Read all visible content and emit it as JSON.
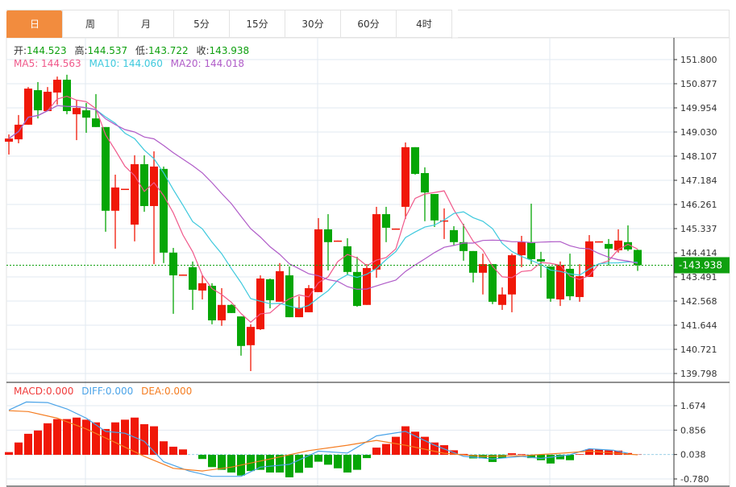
{
  "tabs": [
    {
      "label": "日",
      "active": true
    },
    {
      "label": "周"
    },
    {
      "label": "月"
    },
    {
      "label": "5分"
    },
    {
      "label": "15分"
    },
    {
      "label": "30分"
    },
    {
      "label": "60分"
    },
    {
      "label": "4时"
    }
  ],
  "ohlc_legend": {
    "open_label": "开:",
    "open": "144.523",
    "high_label": "高:",
    "high": "144.537",
    "low_label": "低:",
    "low": "143.722",
    "close_label": "收:",
    "close": "143.938"
  },
  "ma_legend": {
    "ma5": "MA5: 144.563",
    "ma10": "MA10: 144.060",
    "ma20": "MA20: 144.018"
  },
  "macd_legend": {
    "macd": "MACD:0.000",
    "diff": "DIFF:0.000",
    "dea": "DEA:0.000"
  },
  "colors": {
    "up": "#f01808",
    "down": "#06a606",
    "ma5": "#f0588a",
    "ma10": "#3ec9dd",
    "ma20": "#b05cc8",
    "diff": "#4aa3e8",
    "dea": "#f57c20",
    "active_tab": "#f28c3e"
  },
  "chart_data": [
    {
      "type": "candlestick",
      "title": "K线",
      "last_price": "143.938",
      "yticks": [
        "151.800",
        "150.877",
        "149.954",
        "149.030",
        "148.107",
        "147.184",
        "146.261",
        "145.337",
        "144.414",
        "143.491",
        "142.568",
        "141.644",
        "140.721",
        "139.798"
      ],
      "ylim": [
        139.798,
        151.8
      ],
      "candles": [
        [
          148.66,
          148.94,
          148.17,
          148.78
        ],
        [
          148.75,
          149.68,
          148.6,
          149.31
        ],
        [
          149.31,
          150.75,
          149.31,
          150.69
        ],
        [
          150.63,
          150.94,
          149.55,
          149.86
        ],
        [
          149.83,
          150.75,
          149.83,
          150.57
        ],
        [
          150.54,
          151.15,
          150.08,
          151.03
        ],
        [
          151.03,
          151.22,
          149.71,
          149.83
        ],
        [
          149.71,
          150.26,
          148.72,
          149.95
        ],
        [
          149.86,
          150.14,
          149.0,
          149.58
        ],
        [
          149.55,
          150.48,
          149.22,
          149.22
        ],
        [
          149.22,
          149.22,
          145.22,
          146.02
        ],
        [
          146.02,
          147.4,
          144.57,
          146.91
        ],
        [
          146.85,
          146.85,
          146.85,
          146.86
        ],
        [
          145.49,
          148.14,
          144.85,
          147.8
        ],
        [
          147.8,
          148.14,
          145.98,
          146.2
        ],
        [
          146.2,
          148.29,
          143.98,
          147.71
        ],
        [
          147.62,
          147.71,
          144.02,
          144.42
        ],
        [
          144.42,
          144.6,
          142.08,
          143.55
        ],
        [
          143.57,
          143.58,
          143.57,
          143.58
        ],
        [
          143.86,
          144.08,
          142.23,
          143.0
        ],
        [
          142.97,
          143.55,
          142.63,
          143.25
        ],
        [
          143.15,
          143.25,
          141.68,
          141.83
        ],
        [
          141.83,
          143.06,
          141.62,
          142.42
        ],
        [
          142.42,
          142.45,
          142.11,
          142.11
        ],
        [
          141.98,
          141.98,
          140.48,
          140.85
        ],
        [
          140.88,
          141.68,
          139.89,
          141.58
        ],
        [
          141.49,
          143.55,
          141.46,
          143.43
        ],
        [
          143.4,
          143.43,
          142.29,
          142.6
        ],
        [
          142.54,
          144.02,
          142.54,
          143.71
        ],
        [
          143.55,
          143.89,
          141.95,
          141.95
        ],
        [
          141.95,
          142.75,
          141.95,
          142.32
        ],
        [
          142.14,
          143.18,
          142.14,
          143.06
        ],
        [
          142.91,
          145.74,
          142.91,
          145.31
        ],
        [
          145.31,
          145.89,
          143.74,
          144.82
        ],
        [
          144.87,
          144.88,
          144.87,
          144.88
        ],
        [
          144.66,
          144.97,
          143.55,
          143.68
        ],
        [
          143.68,
          144.26,
          142.35,
          142.38
        ],
        [
          142.42,
          143.98,
          142.42,
          143.83
        ],
        [
          143.77,
          146.17,
          143.46,
          145.89
        ],
        [
          145.89,
          146.17,
          144.82,
          145.37
        ],
        [
          145.33,
          145.34,
          145.33,
          145.34
        ],
        [
          146.17,
          148.63,
          145.71,
          148.45
        ],
        [
          148.45,
          148.45,
          147.4,
          147.43
        ],
        [
          147.46,
          147.68,
          145.62,
          146.72
        ],
        [
          146.66,
          146.66,
          145.4,
          145.65
        ],
        [
          145.64,
          146.11,
          144.94,
          145.65
        ],
        [
          145.28,
          145.43,
          144.69,
          144.82
        ],
        [
          144.82,
          145.52,
          144.11,
          144.48
        ],
        [
          144.48,
          144.48,
          143.28,
          143.65
        ],
        [
          143.65,
          144.38,
          142.82,
          143.98
        ],
        [
          143.98,
          143.98,
          142.45,
          142.54
        ],
        [
          142.42,
          143.09,
          142.23,
          142.82
        ],
        [
          142.82,
          144.38,
          142.14,
          144.32
        ],
        [
          144.32,
          145.06,
          143.86,
          144.82
        ],
        [
          144.82,
          146.29,
          143.98,
          144.17
        ],
        [
          144.17,
          144.45,
          143.46,
          144.08
        ],
        [
          143.89,
          143.89,
          142.54,
          142.66
        ],
        [
          142.63,
          144.08,
          142.38,
          143.95
        ],
        [
          143.8,
          144.38,
          142.6,
          142.75
        ],
        [
          142.72,
          143.98,
          142.54,
          143.52
        ],
        [
          143.49,
          145.09,
          143.49,
          144.85
        ],
        [
          144.84,
          144.85,
          144.84,
          144.85
        ],
        [
          144.75,
          144.94,
          143.92,
          144.57
        ],
        [
          144.51,
          145.31,
          144.42,
          144.88
        ],
        [
          144.82,
          145.46,
          144.48,
          144.54
        ],
        [
          144.523,
          144.537,
          143.722,
          143.938
        ]
      ],
      "ma_periods": [
        5,
        10,
        20
      ]
    },
    {
      "type": "macd",
      "yticks": [
        "1.674",
        "0.856",
        "0.038",
        "-0.780"
      ],
      "ylim": [
        -0.95,
        1.95
      ],
      "histogram": [
        0.09,
        0.41,
        0.7,
        0.81,
        1.05,
        1.19,
        1.19,
        1.24,
        1.17,
        1.08,
        0.86,
        1.08,
        1.17,
        1.24,
        1.02,
        0.95,
        0.45,
        0.27,
        0.18,
        0.0,
        -0.14,
        -0.41,
        -0.5,
        -0.59,
        -0.69,
        -0.54,
        -0.5,
        -0.59,
        -0.59,
        -0.75,
        -0.6,
        -0.43,
        -0.23,
        -0.33,
        -0.45,
        -0.59,
        -0.5,
        -0.11,
        0.24,
        0.36,
        0.6,
        0.95,
        0.77,
        0.6,
        0.41,
        0.32,
        0.15,
        0.03,
        -0.12,
        -0.12,
        -0.24,
        -0.11,
        0.05,
        0.02,
        -0.11,
        -0.18,
        -0.29,
        -0.15,
        -0.18,
        0.02,
        0.18,
        0.18,
        0.15,
        0.14,
        0.06,
        0.01
      ],
      "diff": [
        [
          0,
          1.49
        ],
        [
          1.8,
          1.76
        ],
        [
          4,
          1.74
        ],
        [
          6,
          1.53
        ],
        [
          8,
          1.22
        ],
        [
          10,
          0.78
        ],
        [
          12,
          0.72
        ],
        [
          14,
          0.45
        ],
        [
          16,
          -0.23
        ],
        [
          18.6,
          -0.54
        ],
        [
          21,
          -0.72
        ],
        [
          24,
          -0.72
        ],
        [
          26,
          -0.41
        ],
        [
          29,
          -0.32
        ],
        [
          32,
          0.12
        ],
        [
          35,
          0.06
        ],
        [
          38,
          0.63
        ],
        [
          41,
          0.78
        ],
        [
          44,
          0.32
        ],
        [
          47,
          -0.05
        ],
        [
          50,
          -0.14
        ],
        [
          53,
          -0.05
        ],
        [
          55,
          -0.12
        ],
        [
          58,
          0.0
        ],
        [
          60,
          0.2
        ],
        [
          62.5,
          0.15
        ],
        [
          64,
          0.05
        ]
      ],
      "dea": [
        [
          0,
          1.47
        ],
        [
          2,
          1.44
        ],
        [
          5,
          1.22
        ],
        [
          8,
          0.86
        ],
        [
          11,
          0.41
        ],
        [
          14,
          -0.05
        ],
        [
          17,
          -0.45
        ],
        [
          20,
          -0.54
        ],
        [
          23,
          -0.41
        ],
        [
          27,
          -0.14
        ],
        [
          31,
          0.14
        ],
        [
          35,
          0.32
        ],
        [
          38,
          0.48
        ],
        [
          41,
          0.32
        ],
        [
          45,
          0.05
        ],
        [
          49,
          -0.05
        ],
        [
          53,
          -0.03
        ],
        [
          57,
          0.05
        ],
        [
          60,
          0.12
        ],
        [
          62.5,
          0.06
        ],
        [
          65,
          0.0
        ]
      ]
    }
  ]
}
